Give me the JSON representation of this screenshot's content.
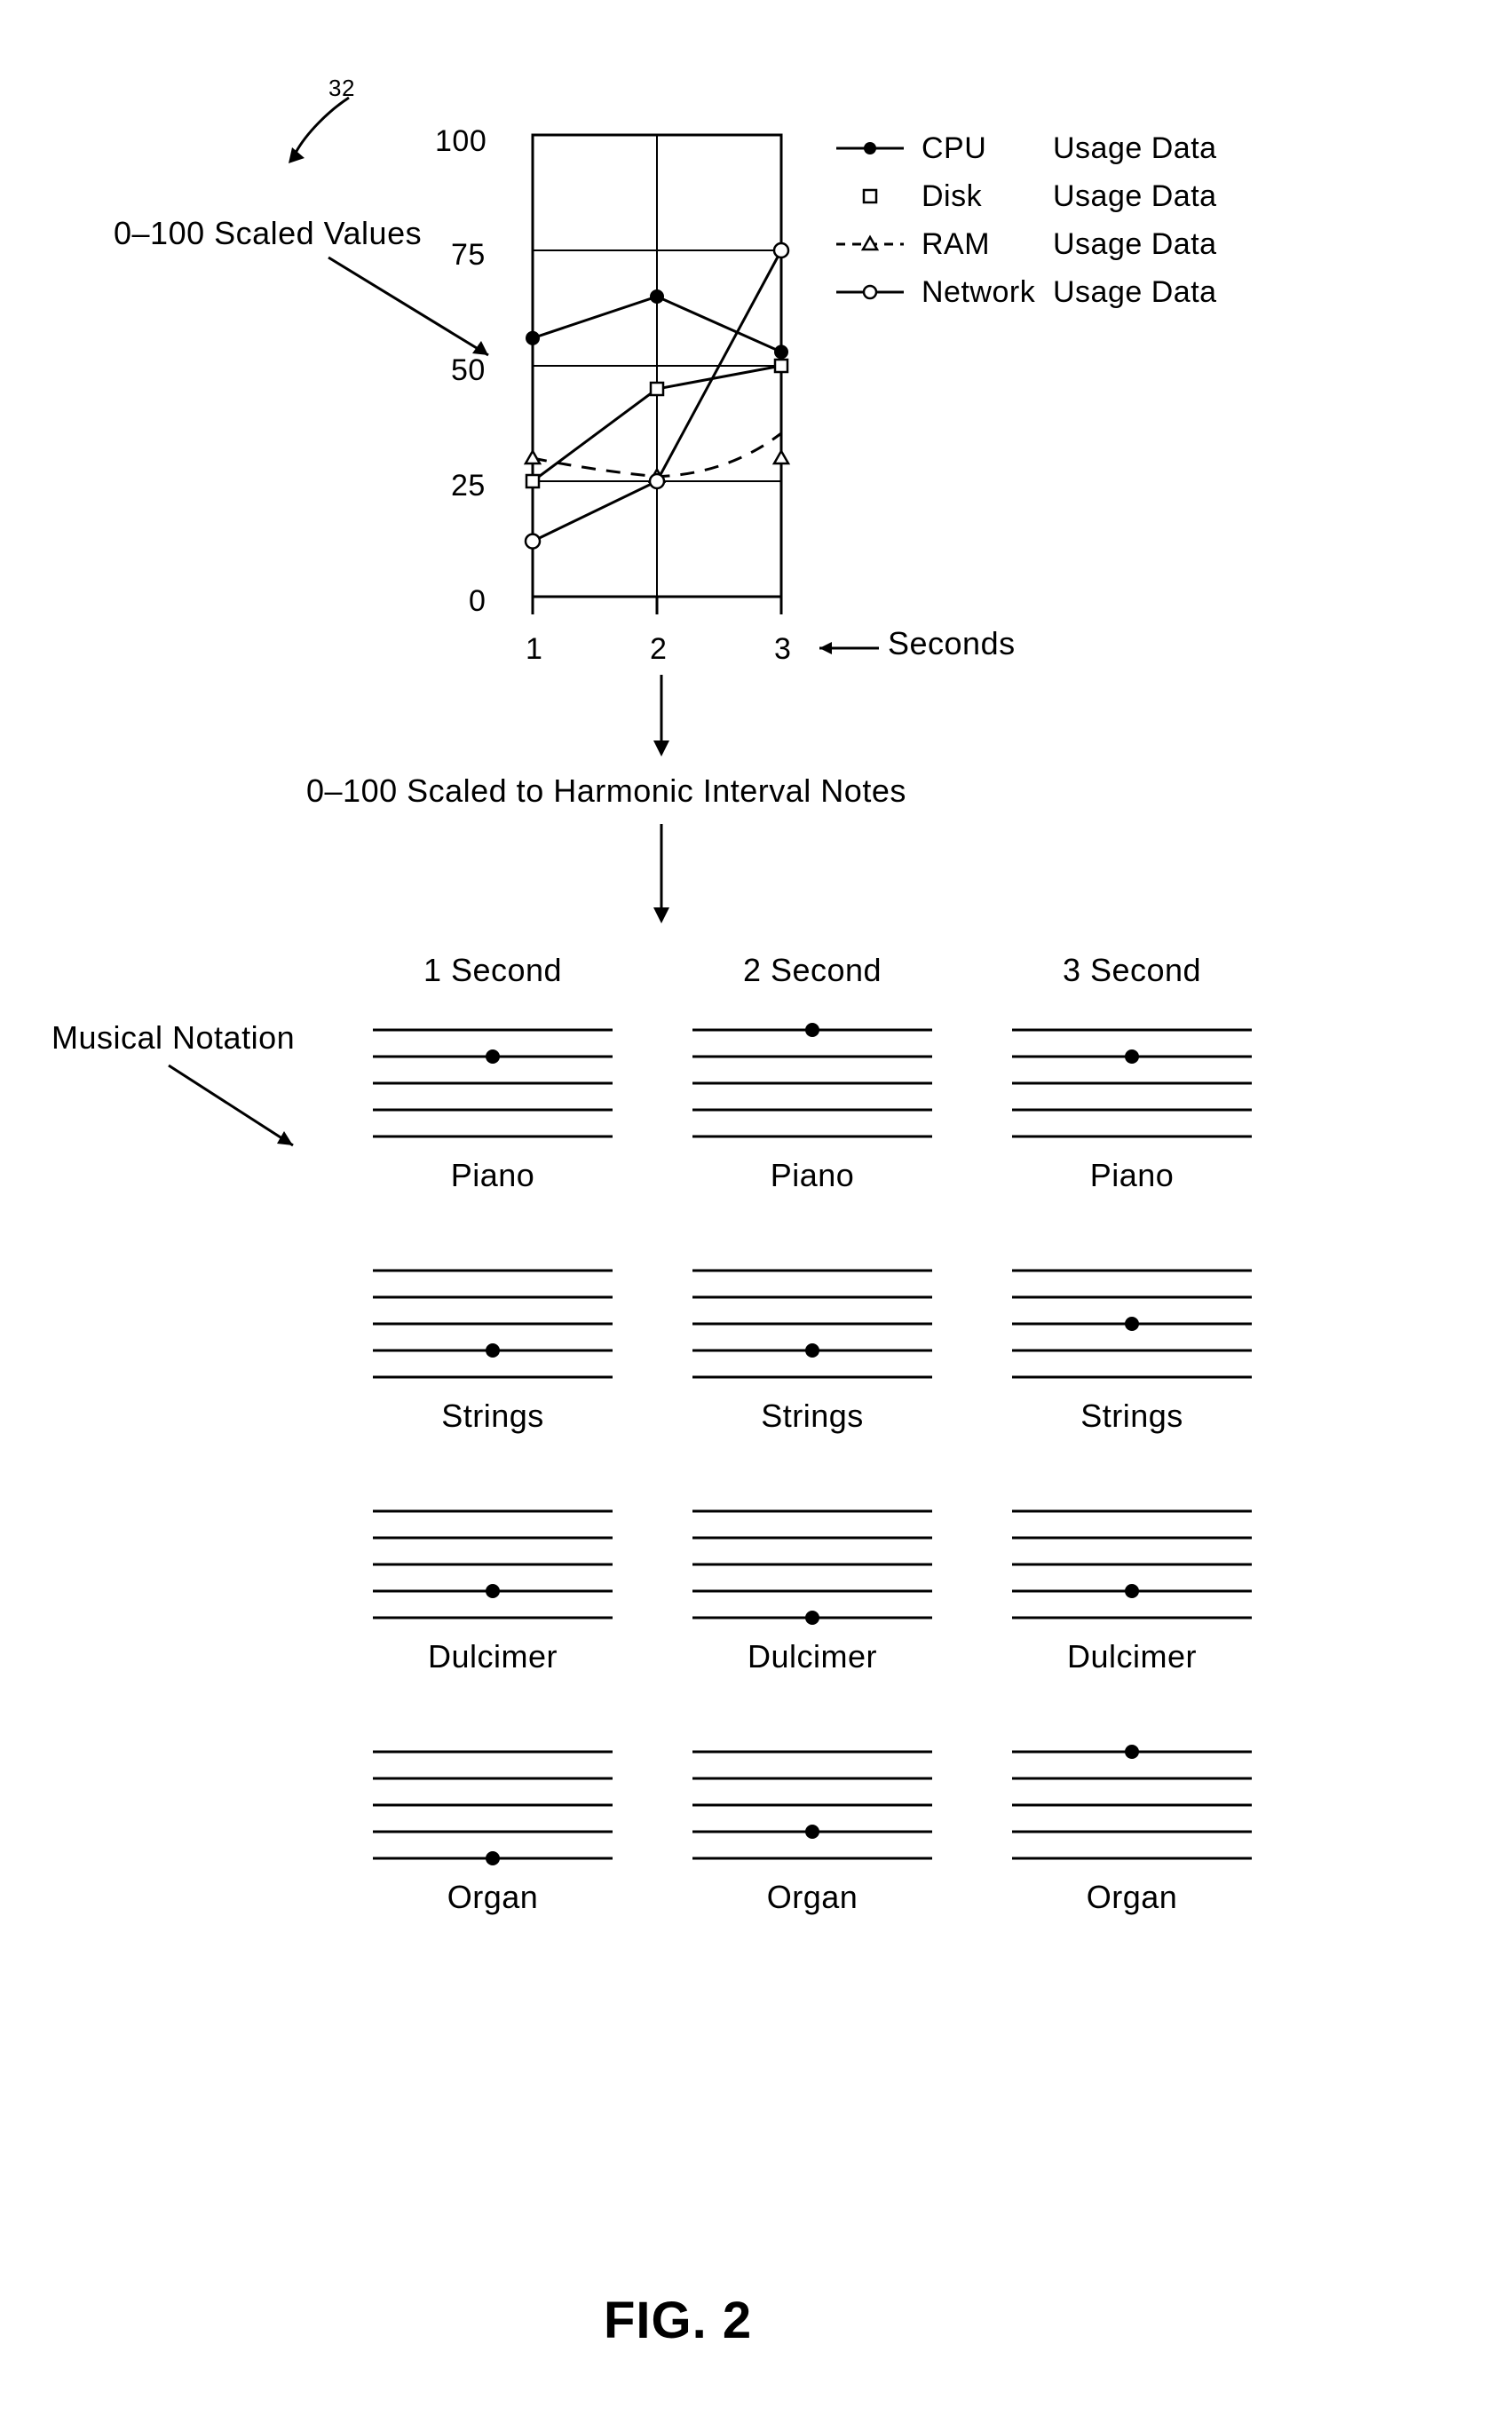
{
  "figure_label": "FIG. 2",
  "ref_numeral": "32",
  "annotations": {
    "scaled_values": "0–100 Scaled Values",
    "seconds_axis": "Seconds",
    "scaled_to_harmonic": "0–100 Scaled to Harmonic Interval Notes",
    "musical_notation": "Musical Notation"
  },
  "chart_data": {
    "type": "line",
    "xlabel": "Seconds",
    "ylabel": "",
    "x": [
      1,
      2,
      3
    ],
    "ylim": [
      0,
      100
    ],
    "yticks": [
      0,
      25,
      50,
      75,
      100
    ],
    "series": [
      {
        "name": "CPU",
        "suffix": "Usage Data",
        "values": [
          56,
          65,
          53
        ],
        "marker": "filled-circle",
        "dash": "solid"
      },
      {
        "name": "Disk",
        "suffix": "Usage Data",
        "values": [
          25,
          45,
          50
        ],
        "marker": "open-square",
        "dash": "solid"
      },
      {
        "name": "RAM",
        "suffix": "Usage Data",
        "values": [
          30,
          26,
          30
        ],
        "marker": "open-triangle",
        "dash": "dashed"
      },
      {
        "name": "Network",
        "suffix": "Usage Data",
        "values": [
          12,
          25,
          75
        ],
        "marker": "open-circle",
        "dash": "solid"
      }
    ]
  },
  "notation_grid": {
    "column_headers": [
      "1 Second",
      "2 Second",
      "3 Second"
    ],
    "rows": [
      {
        "instrument": "Piano",
        "note_line": [
          3,
          4,
          3
        ]
      },
      {
        "instrument": "Strings",
        "note_line": [
          1,
          1,
          2
        ]
      },
      {
        "instrument": "Dulcimer",
        "note_line": [
          1,
          0,
          1
        ]
      },
      {
        "instrument": "Organ",
        "note_line": [
          0,
          1,
          4
        ]
      }
    ],
    "line_count": 5
  }
}
